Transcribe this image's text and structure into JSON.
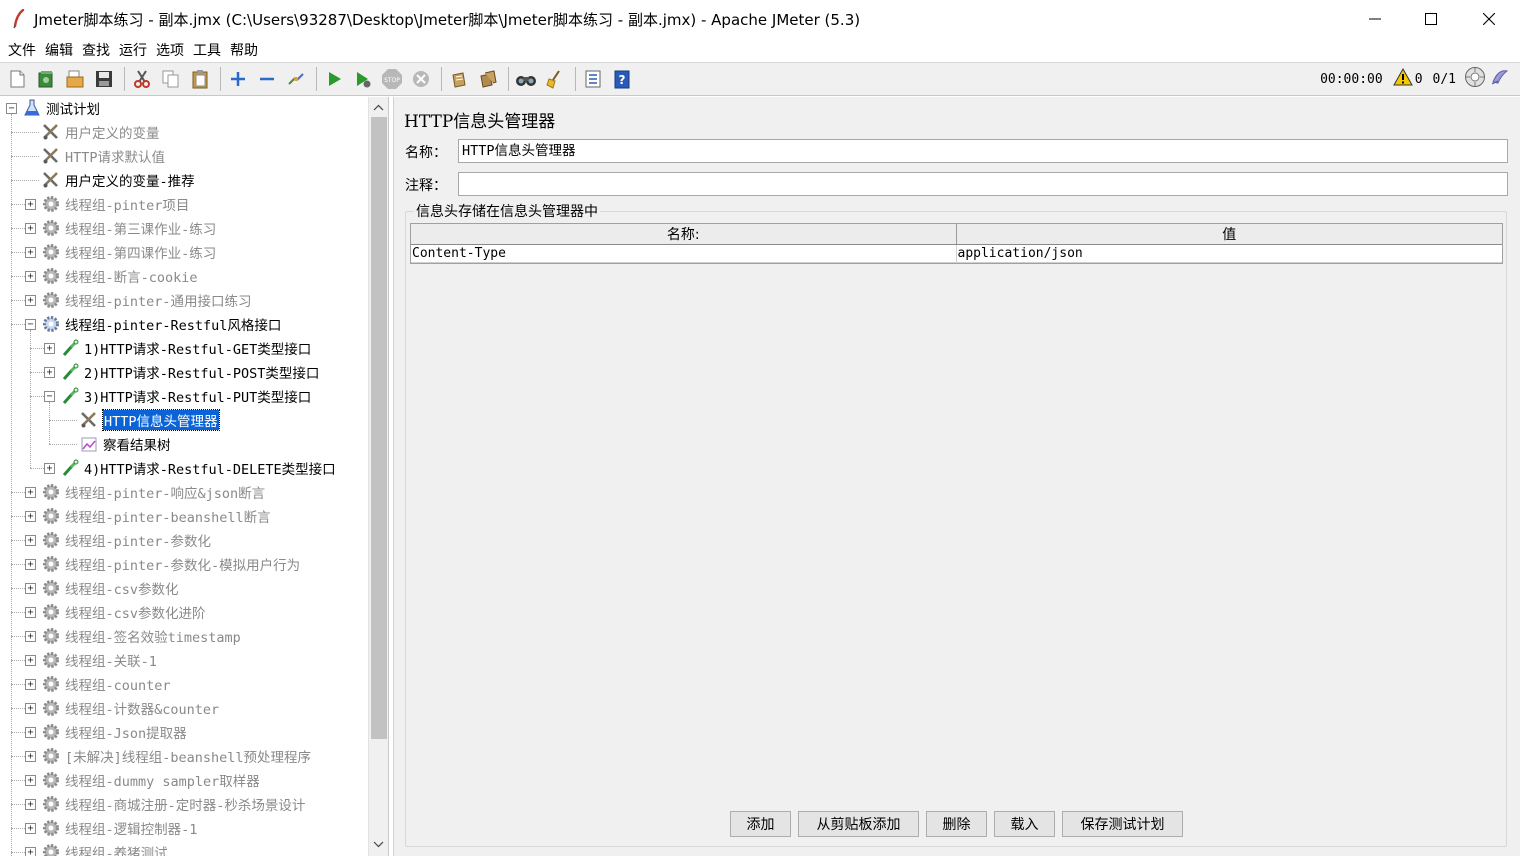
{
  "window": {
    "title": "Jmeter脚本练习 - 副本.jmx (C:\\Users\\93287\\Desktop\\Jmeter脚本\\Jmeter脚本练习 - 副本.jmx) - Apache JMeter (5.3)"
  },
  "menu": [
    "文件",
    "编辑",
    "查找",
    "运行",
    "选项",
    "工具",
    "帮助"
  ],
  "toolbar": {
    "icons": [
      "new-icon",
      "templates-icon",
      "open-icon",
      "save-icon",
      "cut-icon",
      "copy-icon",
      "paste-icon",
      "expand-icon",
      "collapse-icon",
      "toggle-icon",
      "start-icon",
      "start-no-pause-icon",
      "stop-icon",
      "shutdown-icon",
      "clear-icon",
      "clear-all-icon",
      "search-icon",
      "reset-search-icon",
      "function-helper-icon",
      "help-icon"
    ],
    "timer": "00:00:00",
    "warning_count": "0",
    "threads": "0/1"
  },
  "tree": [
    {
      "label": "测试计划",
      "level": 0,
      "icon": "test-plan-icon",
      "expander": "minus",
      "state": "normal"
    },
    {
      "label": "用户定义的变量",
      "level": 1,
      "icon": "config-element-icon",
      "expander": "none",
      "state": "disabled"
    },
    {
      "label": "HTTP请求默认值",
      "level": 1,
      "icon": "config-element-icon",
      "expander": "none",
      "state": "disabled"
    },
    {
      "label": "用户定义的变量-推荐",
      "level": 1,
      "icon": "config-element-icon",
      "expander": "none",
      "state": "normal"
    },
    {
      "label": "线程组-pinter项目",
      "level": 1,
      "icon": "thread-group-icon",
      "expander": "plus",
      "state": "disabled"
    },
    {
      "label": "线程组-第三课作业-练习",
      "level": 1,
      "icon": "thread-group-icon",
      "expander": "plus",
      "state": "disabled"
    },
    {
      "label": "线程组-第四课作业-练习",
      "level": 1,
      "icon": "thread-group-icon",
      "expander": "plus",
      "state": "disabled"
    },
    {
      "label": "线程组-断言-cookie",
      "level": 1,
      "icon": "thread-group-icon",
      "expander": "plus",
      "state": "disabled"
    },
    {
      "label": "线程组-pinter-通用接口练习",
      "level": 1,
      "icon": "thread-group-icon",
      "expander": "plus",
      "state": "disabled"
    },
    {
      "label": "线程组-pinter-Restful风格接口",
      "level": 1,
      "icon": "thread-group-icon",
      "expander": "minus",
      "state": "normal"
    },
    {
      "label": "1)HTTP请求-Restful-GET类型接口",
      "level": 2,
      "icon": "sampler-icon",
      "expander": "plus",
      "state": "normal"
    },
    {
      "label": "2)HTTP请求-Restful-POST类型接口",
      "level": 2,
      "icon": "sampler-icon",
      "expander": "plus",
      "state": "normal"
    },
    {
      "label": "3)HTTP请求-Restful-PUT类型接口",
      "level": 2,
      "icon": "sampler-icon",
      "expander": "minus",
      "state": "normal"
    },
    {
      "label": "HTTP信息头管理器",
      "level": 3,
      "icon": "config-element-icon",
      "expander": "none",
      "state": "selected"
    },
    {
      "label": "察看结果树",
      "level": 3,
      "icon": "listener-icon",
      "expander": "none",
      "state": "normal"
    },
    {
      "label": "4)HTTP请求-Restful-DELETE类型接口",
      "level": 2,
      "icon": "sampler-icon",
      "expander": "plus",
      "state": "normal"
    },
    {
      "label": "线程组-pinter-响应&json断言",
      "level": 1,
      "icon": "thread-group-icon",
      "expander": "plus",
      "state": "disabled"
    },
    {
      "label": "线程组-pinter-beanshell断言",
      "level": 1,
      "icon": "thread-group-icon",
      "expander": "plus",
      "state": "disabled"
    },
    {
      "label": "线程组-pinter-参数化",
      "level": 1,
      "icon": "thread-group-icon",
      "expander": "plus",
      "state": "disabled"
    },
    {
      "label": "线程组-pinter-参数化-模拟用户行为",
      "level": 1,
      "icon": "thread-group-icon",
      "expander": "plus",
      "state": "disabled"
    },
    {
      "label": "线程组-csv参数化",
      "level": 1,
      "icon": "thread-group-icon",
      "expander": "plus",
      "state": "disabled"
    },
    {
      "label": "线程组-csv参数化进阶",
      "level": 1,
      "icon": "thread-group-icon",
      "expander": "plus",
      "state": "disabled"
    },
    {
      "label": "线程组-签名效验timestamp",
      "level": 1,
      "icon": "thread-group-icon",
      "expander": "plus",
      "state": "disabled"
    },
    {
      "label": "线程组-关联-1",
      "level": 1,
      "icon": "thread-group-icon",
      "expander": "plus",
      "state": "disabled"
    },
    {
      "label": "线程组-counter",
      "level": 1,
      "icon": "thread-group-icon",
      "expander": "plus",
      "state": "disabled"
    },
    {
      "label": "线程组-计数器&counter",
      "level": 1,
      "icon": "thread-group-icon",
      "expander": "plus",
      "state": "disabled"
    },
    {
      "label": "线程组-Json提取器",
      "level": 1,
      "icon": "thread-group-icon",
      "expander": "plus",
      "state": "disabled"
    },
    {
      "label": "[未解决]线程组-beanshell预处理程序",
      "level": 1,
      "icon": "thread-group-icon",
      "expander": "plus",
      "state": "disabled"
    },
    {
      "label": "线程组-dummy sampler取样器",
      "level": 1,
      "icon": "thread-group-icon",
      "expander": "plus",
      "state": "disabled"
    },
    {
      "label": "线程组-商城注册-定时器-秒杀场景设计",
      "level": 1,
      "icon": "thread-group-icon",
      "expander": "plus",
      "state": "disabled"
    },
    {
      "label": "线程组-逻辑控制器-1",
      "level": 1,
      "icon": "thread-group-icon",
      "expander": "plus",
      "state": "disabled"
    },
    {
      "label": "线程组-养猪测试",
      "level": 1,
      "icon": "thread-group-icon",
      "expander": "plus",
      "state": "disabled"
    }
  ],
  "editor": {
    "title": "HTTP信息头管理器",
    "name_label": "名称：",
    "name_value": "HTTP信息头管理器",
    "comment_label": "注释：",
    "comment_value": "",
    "group_title": "信息头存储在信息头管理器中",
    "table": {
      "columns": [
        "名称:",
        "值"
      ],
      "rows": [
        [
          "Content-Type",
          "application/json"
        ]
      ]
    },
    "buttons": {
      "add": "添加",
      "add_from_clipboard": "从剪贴板添加",
      "delete": "删除",
      "load": "载入",
      "save_test_plan": "保存测试计划"
    }
  },
  "colors": {
    "selection": "#0a64d8",
    "disabled_text": "#8a8a8a",
    "panel_bg": "#f0f0f0"
  }
}
